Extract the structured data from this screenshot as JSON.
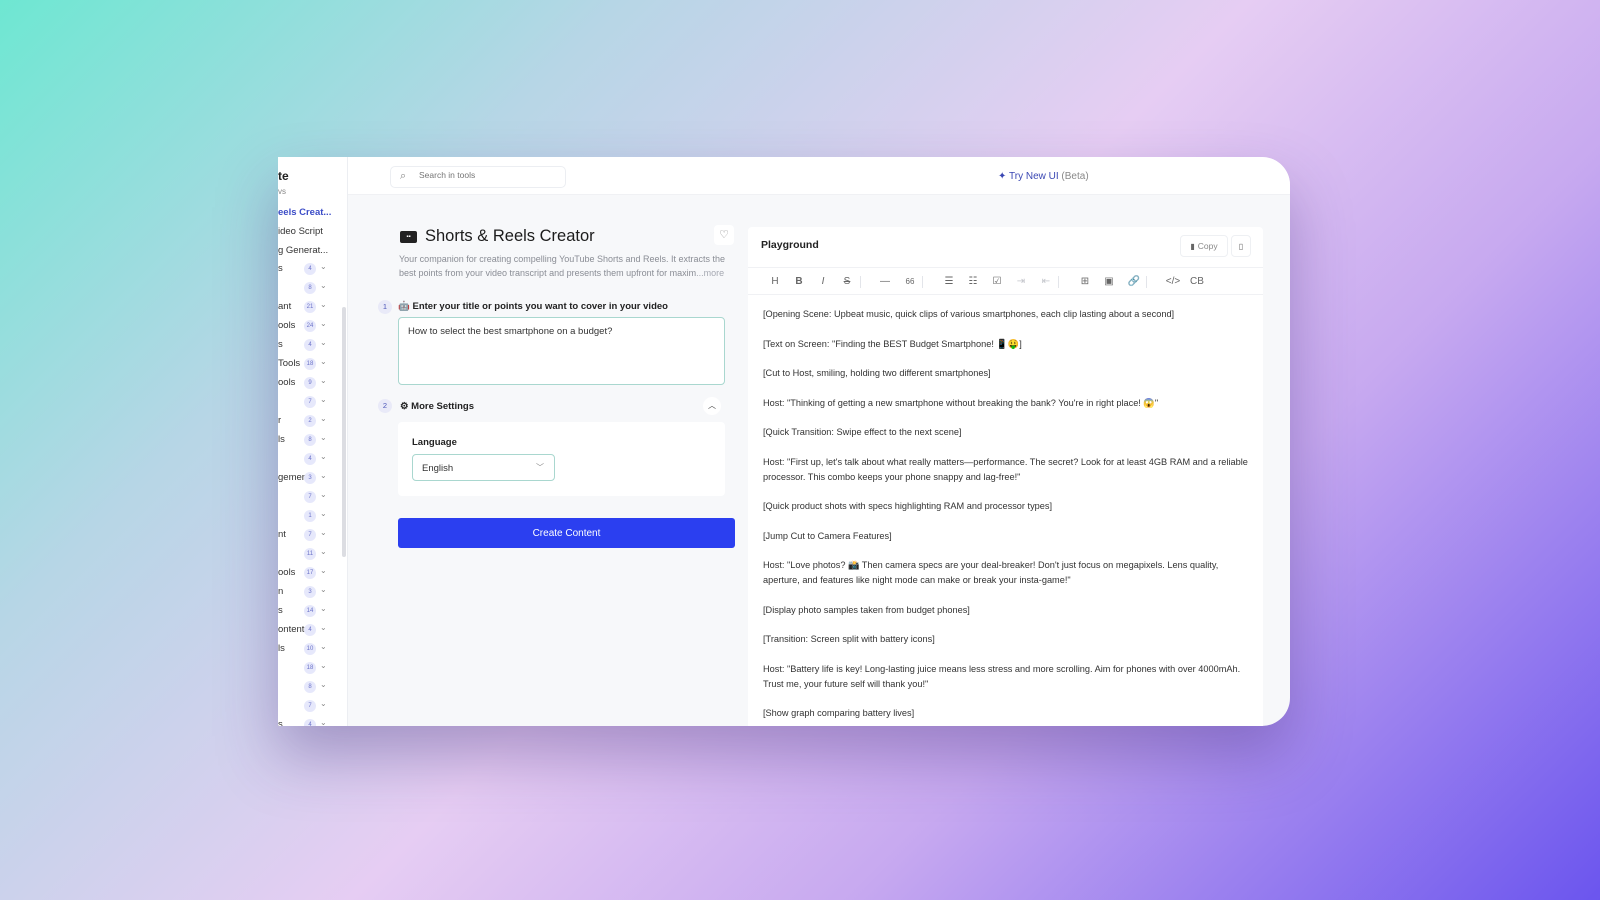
{
  "sidebar": {
    "header": "te",
    "subheader": "vs",
    "links": [
      {
        "label": "eels Creat...",
        "active": true
      },
      {
        "label": "ideo Script",
        "active": false
      },
      {
        "label": "g Generat...",
        "active": false
      }
    ],
    "categories": [
      {
        "label": "s",
        "count": "4"
      },
      {
        "label": "",
        "count": "8"
      },
      {
        "label": "ant",
        "count": "21"
      },
      {
        "label": "ools",
        "count": "24"
      },
      {
        "label": "s",
        "count": "4"
      },
      {
        "label": "Tools",
        "count": "18"
      },
      {
        "label": "ools",
        "count": "9"
      },
      {
        "label": "",
        "count": "7"
      },
      {
        "label": "r",
        "count": "2"
      },
      {
        "label": "ls",
        "count": "8"
      },
      {
        "label": "",
        "count": "4"
      },
      {
        "label": "gemen",
        "count": "3"
      },
      {
        "label": "",
        "count": "7"
      },
      {
        "label": "",
        "count": "1"
      },
      {
        "label": "nt",
        "count": "7"
      },
      {
        "label": "",
        "count": "11"
      },
      {
        "label": "ools",
        "count": "17"
      },
      {
        "label": "n",
        "count": "3"
      },
      {
        "label": "s",
        "count": "14"
      },
      {
        "label": "ontent",
        "count": "4"
      },
      {
        "label": "ls",
        "count": "10"
      },
      {
        "label": "",
        "count": "18"
      },
      {
        "label": "",
        "count": "8"
      },
      {
        "label": "",
        "count": "7"
      },
      {
        "label": "s",
        "count": "4"
      }
    ]
  },
  "topbar": {
    "search_placeholder": "Search in tools",
    "try_new_label": "Try New UI",
    "beta_label": "(Beta)"
  },
  "tool": {
    "title": "Shorts & Reels Creator",
    "icon_text": "(▪▪)",
    "description": "Your companion for creating compelling YouTube Shorts and Reels. It extracts the best points from your video transcript and presents them upfront for maxim",
    "more_label": "...more"
  },
  "form": {
    "step1_number": "1",
    "step1_label": "Enter your title or points you want to cover in your video",
    "step1_value": "How to select the best smartphone on a budget?",
    "step2_number": "2",
    "step2_label": "More Settings",
    "language_label": "Language",
    "language_value": "English",
    "create_button": "Create Content"
  },
  "playground": {
    "title": "Playground",
    "copy_label": "Copy",
    "paragraphs": [
      "[Opening Scene: Upbeat music, quick clips of various smartphones, each clip lasting about a second]",
      "[Text on Screen: \"Finding the BEST Budget Smartphone! 📱🤑]",
      "[Cut to Host, smiling, holding two different smartphones]",
      "Host: \"Thinking of getting a new smartphone without breaking the bank? You're in right place! 😱\"",
      "[Quick Transition: Swipe effect to the next scene]",
      "Host: \"First up, let's talk about what really matters—performance. The secret? Look for at least 4GB RAM and a reliable processor. This combo keeps your phone snappy and lag-free!\"",
      "[Quick product shots with specs highlighting RAM and processor types]",
      "[Jump Cut to Camera Features]",
      "Host: \"Love photos? 📸 Then camera specs are your deal-breaker! Don't just focus on megapixels. Lens quality, aperture, and features like night mode can make or break your insta-game!\"",
      "[Display photo samples taken from budget phones]",
      "[Transition: Screen split with battery icons]",
      "Host: \"Battery life is key! Long-lasting juice means less stress and more scrolling. Aim for phones with over 4000mAh. Trust me, your future self will thank you!\"",
      "[Show graph comparing battery lives]"
    ]
  },
  "toolbar": {
    "items": [
      {
        "name": "heading-icon",
        "glyph": "H"
      },
      {
        "name": "bold-icon",
        "glyph": "B"
      },
      {
        "name": "italic-icon",
        "glyph": "I"
      },
      {
        "name": "strikethrough-icon",
        "glyph": "S"
      },
      {
        "name": "horizontal-rule-icon",
        "glyph": "—"
      },
      {
        "name": "quote-icon",
        "glyph": "66"
      },
      {
        "name": "bullet-list-icon",
        "glyph": "☰"
      },
      {
        "name": "numbered-list-icon",
        "glyph": "☷"
      },
      {
        "name": "task-list-icon",
        "glyph": "☑"
      },
      {
        "name": "indent-icon",
        "glyph": "⇥"
      },
      {
        "name": "outdent-icon",
        "glyph": "⇤"
      },
      {
        "name": "table-icon",
        "glyph": "⊞"
      },
      {
        "name": "image-icon",
        "glyph": "▣"
      },
      {
        "name": "link-icon",
        "glyph": "🔗"
      },
      {
        "name": "code-icon",
        "glyph": "</>"
      },
      {
        "name": "code-block-icon",
        "glyph": "CB"
      }
    ]
  }
}
